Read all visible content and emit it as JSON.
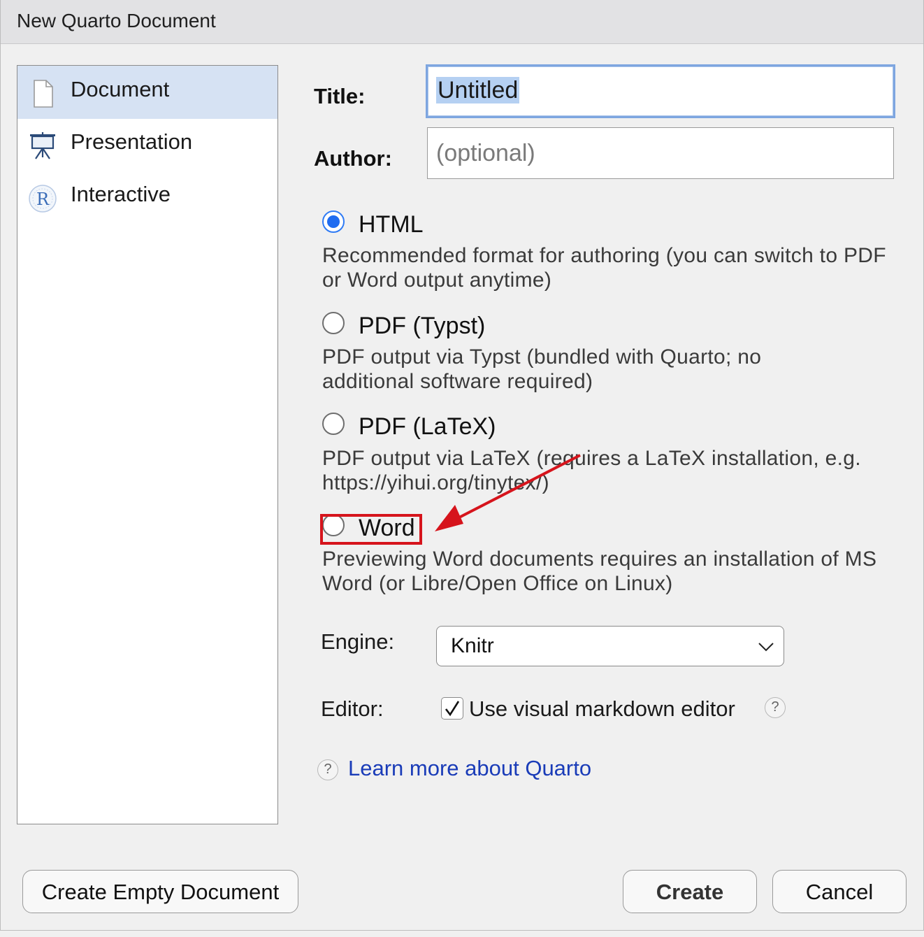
{
  "window": {
    "title": "New Quarto Document"
  },
  "sidebar": {
    "items": [
      {
        "label": "Document",
        "icon": "document-icon",
        "selected": true
      },
      {
        "label": "Presentation",
        "icon": "presentation-icon",
        "selected": false
      },
      {
        "label": "Interactive",
        "icon": "r-logo-icon",
        "selected": false
      }
    ]
  },
  "form": {
    "title_label": "Title:",
    "title_value": "Untitled",
    "author_label": "Author:",
    "author_placeholder": "(optional)"
  },
  "formats": [
    {
      "label": "HTML",
      "description": "Recommended format for authoring (you can switch to PDF or Word output anytime)",
      "checked": true
    },
    {
      "label": "PDF (Typst)",
      "description": "PDF output via Typst (bundled with Quarto; no additional software required)",
      "checked": false
    },
    {
      "label": "PDF (LaTeX)",
      "description": "PDF output via LaTeX (requires a LaTeX installation, e.g. https://yihui.org/tinytex/)",
      "checked": false
    },
    {
      "label": "Word",
      "description": "Previewing Word documents requires an installation of MS Word (or Libre/Open Office on Linux)",
      "checked": false
    }
  ],
  "engine": {
    "label": "Engine:",
    "value": "Knitr"
  },
  "editor": {
    "label": "Editor:",
    "checkbox_label": "Use visual markdown editor",
    "checked": true
  },
  "help_link": "Learn more about Quarto",
  "buttons": {
    "create_empty": "Create Empty Document",
    "create": "Create",
    "cancel": "Cancel"
  },
  "colors": {
    "accent": "#1f6cf0",
    "annotation": "#d6141c",
    "link": "#1a3cb8",
    "selection": "#d6e2f3"
  }
}
